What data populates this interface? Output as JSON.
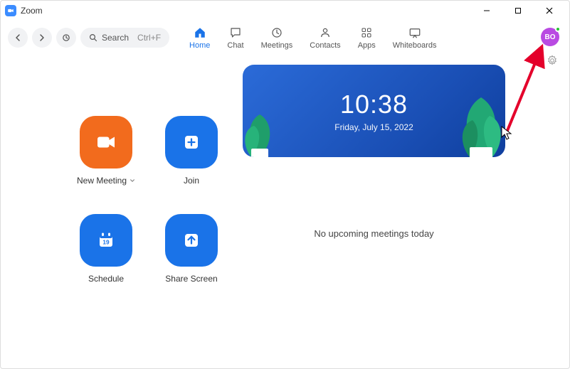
{
  "app": {
    "title": "Zoom"
  },
  "window": {
    "min": "−",
    "max": "☐",
    "close": "✕"
  },
  "nav": {
    "search_label": "Search",
    "search_hint": "Ctrl+F",
    "tabs": [
      {
        "label": "Home"
      },
      {
        "label": "Chat"
      },
      {
        "label": "Meetings"
      },
      {
        "label": "Contacts"
      },
      {
        "label": "Apps"
      },
      {
        "label": "Whiteboards"
      }
    ]
  },
  "avatar": {
    "initials": "BO",
    "color": "#b94ae2",
    "presence": "#27c234"
  },
  "actions": {
    "new_meeting": {
      "label": "New Meeting",
      "color": "#f26b1d"
    },
    "join": {
      "label": "Join",
      "color": "#1a73e8"
    },
    "schedule": {
      "label": "Schedule",
      "color": "#1a73e8",
      "calendar_day": "19"
    },
    "share_screen": {
      "label": "Share Screen",
      "color": "#1a73e8"
    }
  },
  "hero": {
    "time": "10:38",
    "date": "Friday, July 15, 2022"
  },
  "meetings": {
    "empty_text": "No upcoming meetings today"
  }
}
